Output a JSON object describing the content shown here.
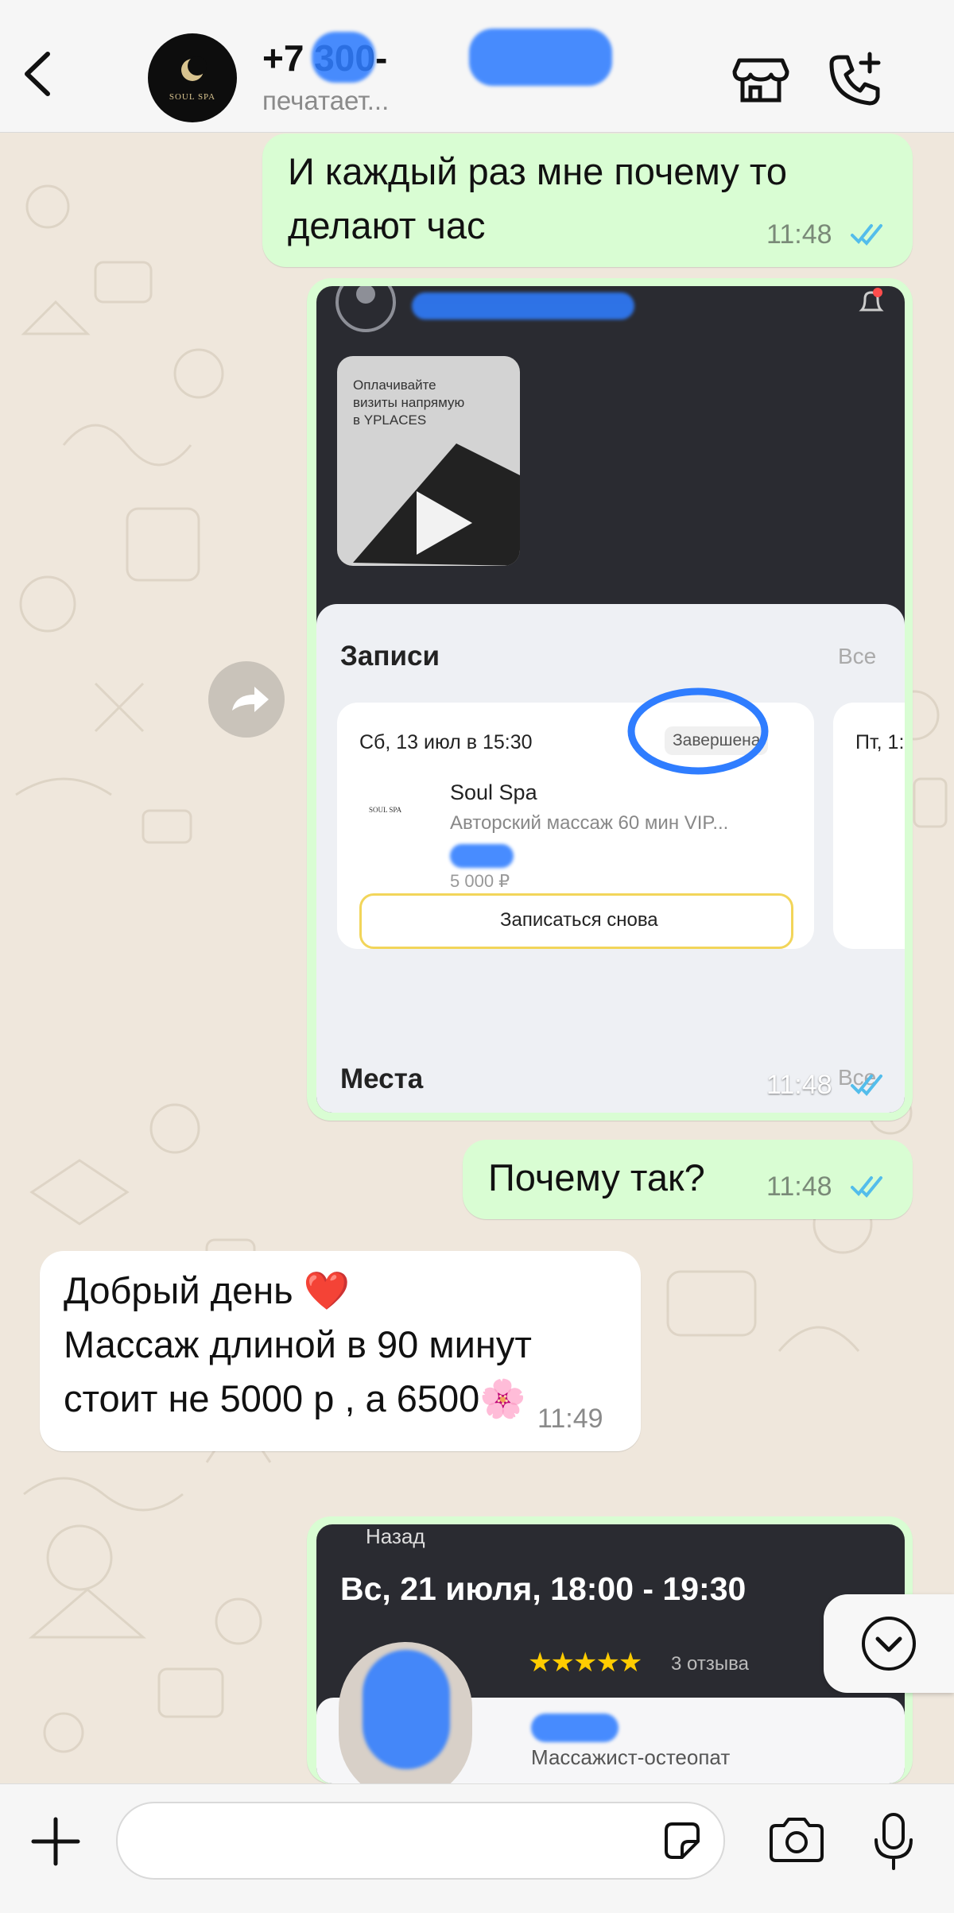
{
  "header": {
    "contact_name": "+7 300-",
    "status": "печатает...",
    "avatar_text": "SOUL SPA",
    "icons": [
      "chevron-left-icon",
      "storefront-icon",
      "phone-plus-icon"
    ]
  },
  "messages": [
    {
      "direction": "out",
      "text": "И каждый раз мне почему то\nделают час",
      "time": "11:48",
      "status": "read"
    },
    {
      "direction": "out",
      "type": "screenshot",
      "time": "11:48",
      "status": "read"
    },
    {
      "direction": "out",
      "text": "Почему так?",
      "time": "11:48",
      "status": "read"
    },
    {
      "direction": "in",
      "text": "Добрый день ❤️\nМассаж длиной в 90 минут\nстоит не 5000 р , а 6500🌸",
      "time": "11:49"
    },
    {
      "direction": "out",
      "type": "screenshot"
    }
  ],
  "screenshot1": {
    "promo_text": "Оплачивайте\nвизиты напрямую\nв YPLACES",
    "section_records": "Записи",
    "see_all": "Все",
    "date": "Сб, 13 июл в 15:30",
    "status_badge": "Завершена",
    "next_date": "Пт, 1:",
    "salon_name": "Soul Spa",
    "logo_text": "SOUL SPA",
    "service": "Авторский массаж 60 мин VIP...",
    "price": "5 000 ₽",
    "rebook": "Записаться снова",
    "section_places": "Места",
    "see_all_places": "Все"
  },
  "screenshot2": {
    "back": "Назад",
    "datetime": "Вс, 21 июля, 18:00 - 19:30",
    "stars": "★★★★★",
    "reviews": "3 отзыва",
    "role": "Массажист-остеопат"
  },
  "colors": {
    "outgoing": "#d9fdd3",
    "incoming": "#ffffff",
    "read_ticks": "#53bdeb",
    "scribble": "#2f7dff",
    "star": "#ffcc00"
  }
}
